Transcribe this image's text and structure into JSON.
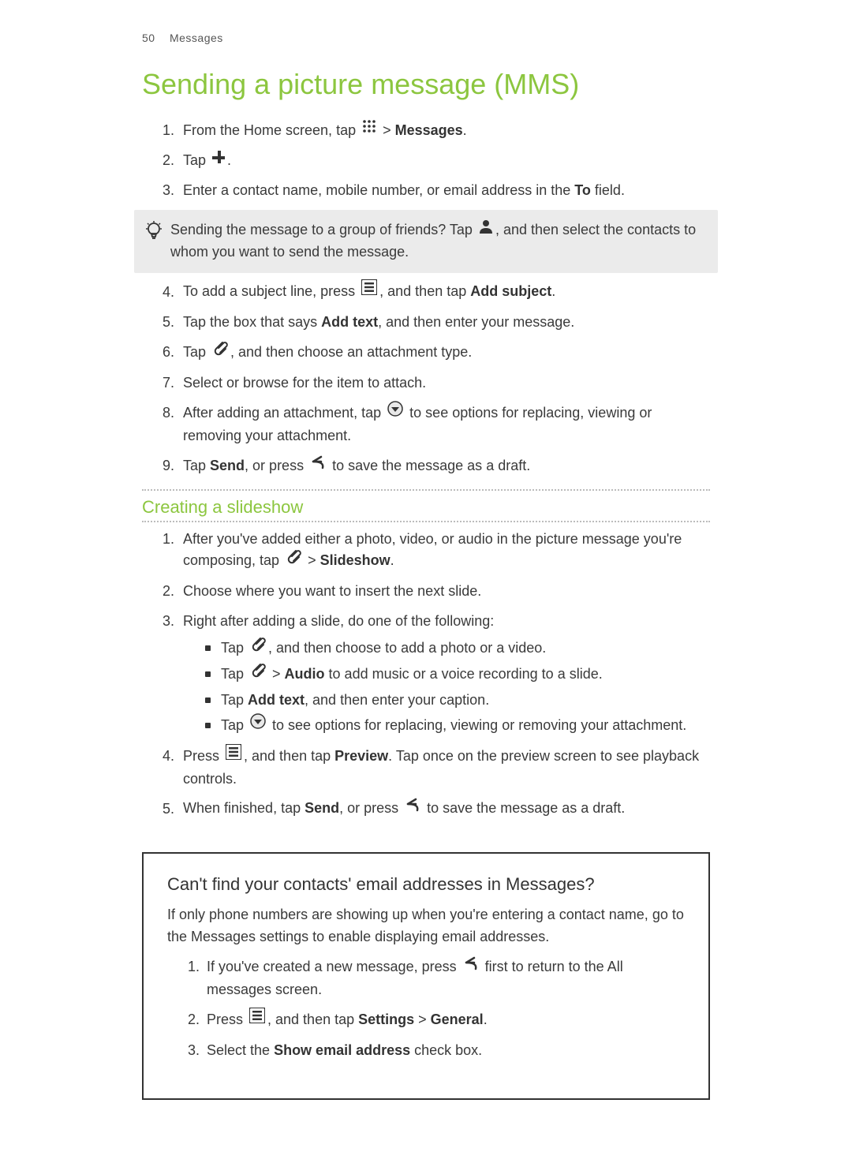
{
  "header": {
    "page_num": "50",
    "section": "Messages"
  },
  "main_title": "Sending a picture message (MMS)",
  "step1": {
    "a": "From the Home screen, tap ",
    "b": " > ",
    "msg": "Messages",
    "c": "."
  },
  "step2": {
    "a": "Tap ",
    "b": "."
  },
  "step3": {
    "a": "Enter a contact name, mobile number, or email address in the ",
    "to": "To",
    "b": " field."
  },
  "tip": {
    "a": "Sending the message to a group of friends? Tap ",
    "b": ", and then select the contacts to whom you want to send the message."
  },
  "step4": {
    "a": "To add a subject line, press ",
    "b": ", and then tap ",
    "add": "Add subject",
    "c": "."
  },
  "step5": {
    "a": "Tap the box that says ",
    "add": "Add text",
    "b": ", and then enter your message."
  },
  "step6": {
    "a": "Tap ",
    "b": ", and then choose an attachment type."
  },
  "step7": "Select or browse for the item to attach.",
  "step8": {
    "a": "After adding an attachment, tap ",
    "b": " to see options for replacing, viewing or removing your attachment."
  },
  "step9": {
    "a": "Tap ",
    "send": "Send",
    "b": ", or press ",
    "c": " to save the message as a draft."
  },
  "slideshow_title": "Creating a slideshow",
  "ss1": {
    "a": "After you've added either a photo, video, or audio in the picture message you're composing, tap ",
    "b": " > ",
    "slide": "Slideshow",
    "c": "."
  },
  "ss2": "Choose where you want to insert the next slide.",
  "ss3": "Right after adding a slide, do one of the following:",
  "b1": {
    "a": "Tap ",
    "b": ", and then choose to add a photo or a video."
  },
  "b2": {
    "a": "Tap ",
    "b": " > ",
    "audio": "Audio",
    "c": " to add music or a voice recording to a slide."
  },
  "b3": {
    "a": "Tap ",
    "add": "Add text",
    "b": ", and then enter your caption."
  },
  "b4": {
    "a": "Tap ",
    "b": " to see options for replacing, viewing or removing your attachment."
  },
  "ss4": {
    "a": "Press ",
    "b": ", and then tap ",
    "preview": "Preview",
    "c": ". Tap once on the preview screen to see playback controls."
  },
  "ss5": {
    "a": "When finished, tap ",
    "send": "Send",
    "b": ", or press ",
    "c": " to save the message as a draft."
  },
  "framed": {
    "title": "Can't find your contacts' email addresses in Messages?",
    "p": "If only phone numbers are showing up when you're entering a contact name, go to the Messages settings to enable displaying email addresses.",
    "f1": {
      "a": "If you've created a new message, press ",
      "b": " first to return to the All messages screen."
    },
    "f2": {
      "a": "Press ",
      "b": ", and then tap ",
      "settings": "Settings",
      "gt": " > ",
      "general": "General",
      "c": "."
    },
    "f3": {
      "a": "Select the ",
      "show": "Show email address",
      "b": " check box."
    }
  }
}
